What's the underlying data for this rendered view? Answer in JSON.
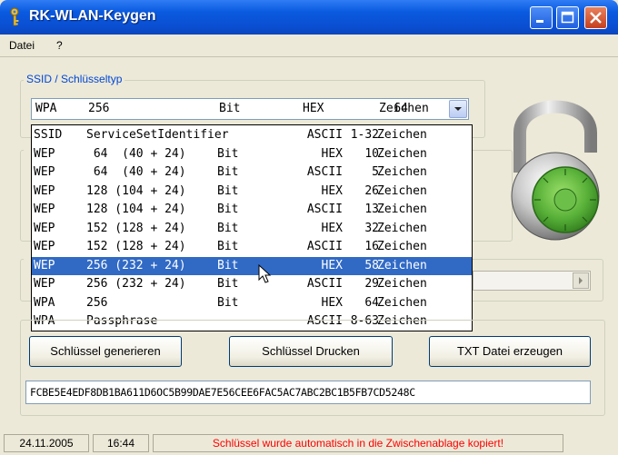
{
  "window": {
    "title": "RK-WLAN-Keygen",
    "colors": {
      "titlebar": "#0a4fd2",
      "selection": "#316ac5",
      "status_red": "#ff0000",
      "lock_green": "#58b038"
    }
  },
  "menu": {
    "items": [
      "Datei",
      "?"
    ]
  },
  "ssid_group": {
    "label": "SSID / Schlüsseltyp"
  },
  "combo": {
    "type": "WPA",
    "size": "256",
    "unit": "Bit",
    "encoding": "HEX",
    "count": "64",
    "suffix": "Zeichen"
  },
  "dropdown": {
    "options": [
      {
        "type": "SSID",
        "size": "ServiceSetIdentifier",
        "unit": "",
        "encoding": "ASCII",
        "count": "1-32",
        "suffix": "Zeichen"
      },
      {
        "type": "WEP",
        "size": " 64  (40 + 24)",
        "unit": "Bit",
        "encoding": "HEX",
        "count": "10",
        "suffix": "Zeichen"
      },
      {
        "type": "WEP",
        "size": " 64  (40 + 24)",
        "unit": "Bit",
        "encoding": "ASCII",
        "count": "5",
        "suffix": "Zeichen"
      },
      {
        "type": "WEP",
        "size": "128 (104 + 24)",
        "unit": "Bit",
        "encoding": "HEX",
        "count": "26",
        "suffix": "Zeichen"
      },
      {
        "type": "WEP",
        "size": "128 (104 + 24)",
        "unit": "Bit",
        "encoding": "ASCII",
        "count": "13",
        "suffix": "Zeichen"
      },
      {
        "type": "WEP",
        "size": "152 (128 + 24)",
        "unit": "Bit",
        "encoding": "HEX",
        "count": "32",
        "suffix": "Zeichen"
      },
      {
        "type": "WEP",
        "size": "152 (128 + 24)",
        "unit": "Bit",
        "encoding": "ASCII",
        "count": "16",
        "suffix": "Zeichen"
      },
      {
        "type": "WEP",
        "size": "256 (232 + 24)",
        "unit": "Bit",
        "encoding": "HEX",
        "count": "58",
        "suffix": "Zeichen"
      },
      {
        "type": "WEP",
        "size": "256 (232 + 24)",
        "unit": "Bit",
        "encoding": "ASCII",
        "count": "29",
        "suffix": "Zeichen"
      },
      {
        "type": "WPA",
        "size": "256",
        "unit": "Bit",
        "encoding": "HEX",
        "count": "64",
        "suffix": "Zeichen"
      },
      {
        "type": "WPA",
        "size": "Passphrase",
        "unit": "",
        "encoding": "ASCII",
        "count": "8-63",
        "suffix": "Zeichen"
      }
    ],
    "selected_index": 7
  },
  "buttons": {
    "generate": "Schlüssel generieren",
    "print": "Schlüssel Drucken",
    "txt": "TXT Datei erzeugen"
  },
  "key_output": {
    "value": "FCBE5E4EDF8DB1BA611D6OC5B99DAE7E56CEE6FAC5AC7ABC2BC1B5FB7CD5248C"
  },
  "status": {
    "date": "24.11.2005",
    "time": "16:44",
    "message": "Schlüssel wurde automatisch in die Zwischenablage kopiert!"
  }
}
